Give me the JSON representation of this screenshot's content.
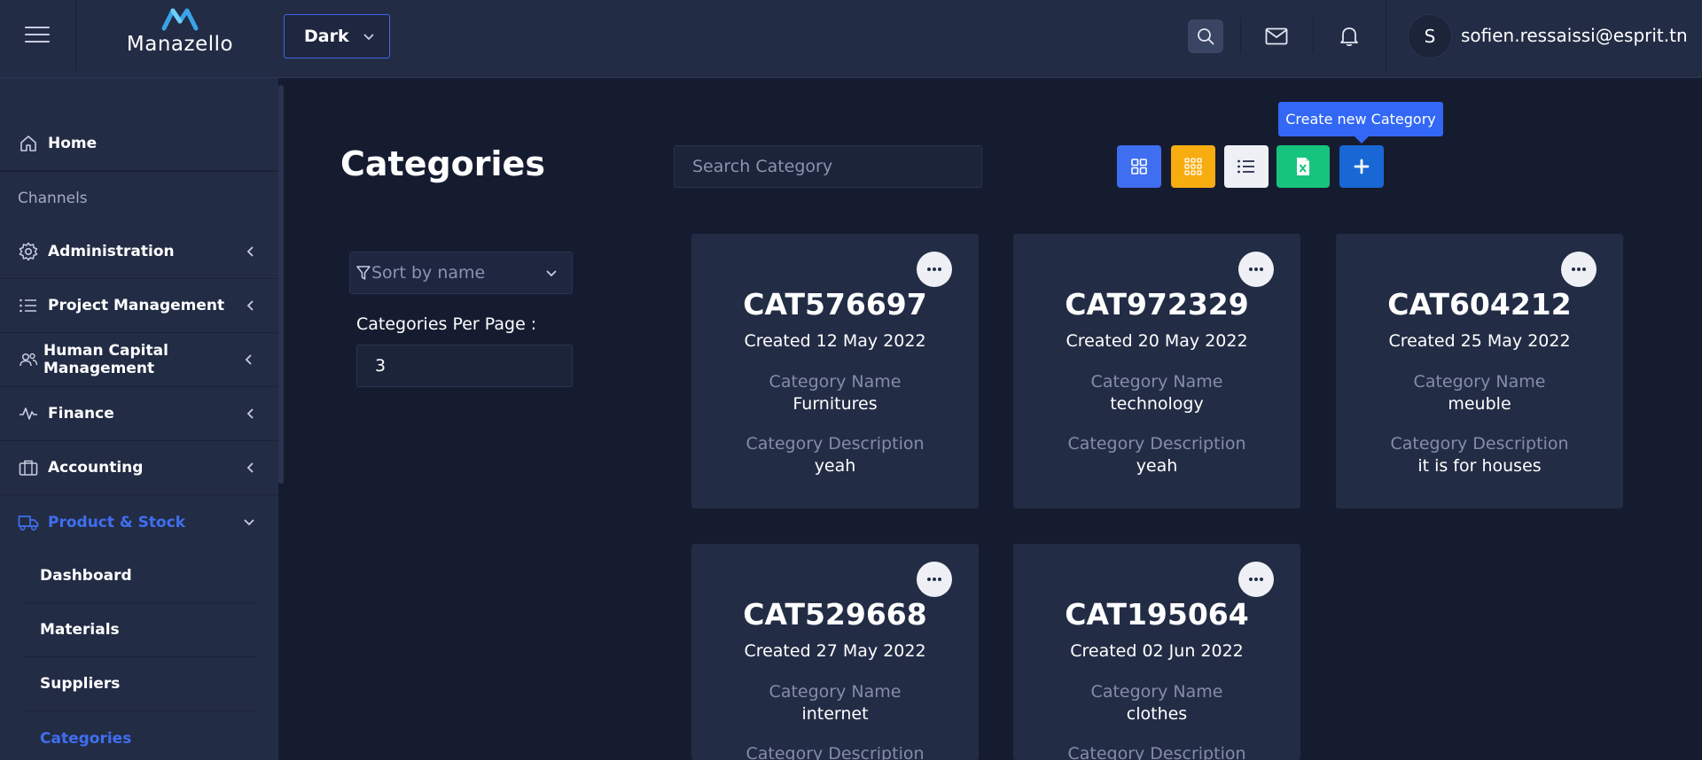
{
  "header": {
    "logo_text": "Manazello",
    "theme_select": "Dark",
    "user_initial": "S",
    "user_email": "sofien.ressaissi@esprit.tn"
  },
  "sidebar": {
    "home": "Home",
    "channels_header": "Channels",
    "administration": "Administration",
    "project_management": "Project Management",
    "human_capital": "Human Capital Management",
    "finance": "Finance",
    "accounting": "Accounting",
    "product_stock": "Product & Stock",
    "sub": {
      "dashboard": "Dashboard",
      "materials": "Materials",
      "suppliers": "Suppliers",
      "categories": "Categories"
    }
  },
  "main": {
    "title": "Categories",
    "search_placeholder": "Search Category",
    "tooltip": "Create new Category",
    "sort_select": "Sort by name",
    "per_page_label": "Categories Per Page :",
    "per_page_value": "3",
    "name_label": "Category Name",
    "desc_label": "Category Description"
  },
  "cards": [
    {
      "code": "CAT576697",
      "created": "Created 12 May 2022",
      "name": "Furnitures",
      "description": "yeah"
    },
    {
      "code": "CAT972329",
      "created": "Created 20 May 2022",
      "name": "technology",
      "description": "yeah"
    },
    {
      "code": "CAT604212",
      "created": "Created 25 May 2022",
      "name": "meuble",
      "description": "it is for houses"
    },
    {
      "code": "CAT529668",
      "created": "Created 27 May 2022",
      "name": "internet",
      "description": ""
    },
    {
      "code": "CAT195064",
      "created": "Created 02 Jun 2022",
      "name": "clothes",
      "description": ""
    }
  ],
  "colors": {
    "accent": "#3f6ff0",
    "grid_view_button": "#3f6ff0",
    "compact_grid_button": "#f7ac0f",
    "list_view_button": "#eef0f6",
    "excel_button": "#17c47d",
    "add_button": "#1867d4"
  }
}
